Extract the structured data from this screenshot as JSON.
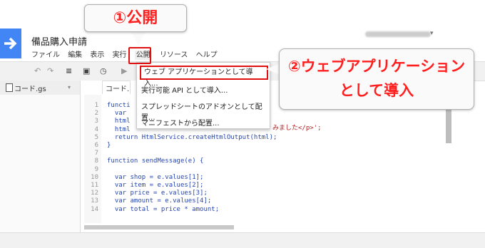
{
  "header": {
    "title": "備品購入申請"
  },
  "menubar": {
    "items": [
      "ファイル",
      "編集",
      "表示",
      "実行",
      "公開",
      "リソース",
      "ヘルプ"
    ]
  },
  "file": {
    "name": "コード.gs"
  },
  "editor": {
    "tab": "コード.",
    "lines": [
      {
        "n": "1",
        "t": "functi"
      },
      {
        "n": "2",
        "t": "  var"
      },
      {
        "n": "3",
        "t": "  html"
      },
      {
        "n": "4",
        "t": "  html"
      },
      {
        "n": "5",
        "t": "  return HtmlService.createHtmlOutput(html);"
      },
      {
        "n": "6",
        "t": "}"
      },
      {
        "n": "7",
        "t": ""
      },
      {
        "n": "8",
        "t": "function sendMessage(e) {"
      },
      {
        "n": "9",
        "t": ""
      },
      {
        "n": "10",
        "t": "  var shop = e.values[1];"
      },
      {
        "n": "11",
        "t": "  var item = e.values[2];"
      },
      {
        "n": "12",
        "t": "  var price = e.values[3];"
      },
      {
        "n": "13",
        "t": "  var amount = e.values[4];"
      },
      {
        "n": "14",
        "t": "  var total = price * amount;"
      }
    ],
    "line4_tail": "みました</p>';"
  },
  "publish_menu": {
    "items": [
      "ウェブ アプリケーションとして導入...",
      "実行可能 API として導入...",
      "スプレッドシートのアドオンとして配置...",
      "マニフェストから配置..."
    ]
  },
  "annotations": {
    "step1": "①公開",
    "step2_line1": "②ウェブアプリケーション",
    "step2_line2": "として導入",
    "color": "#ff1f1f"
  }
}
